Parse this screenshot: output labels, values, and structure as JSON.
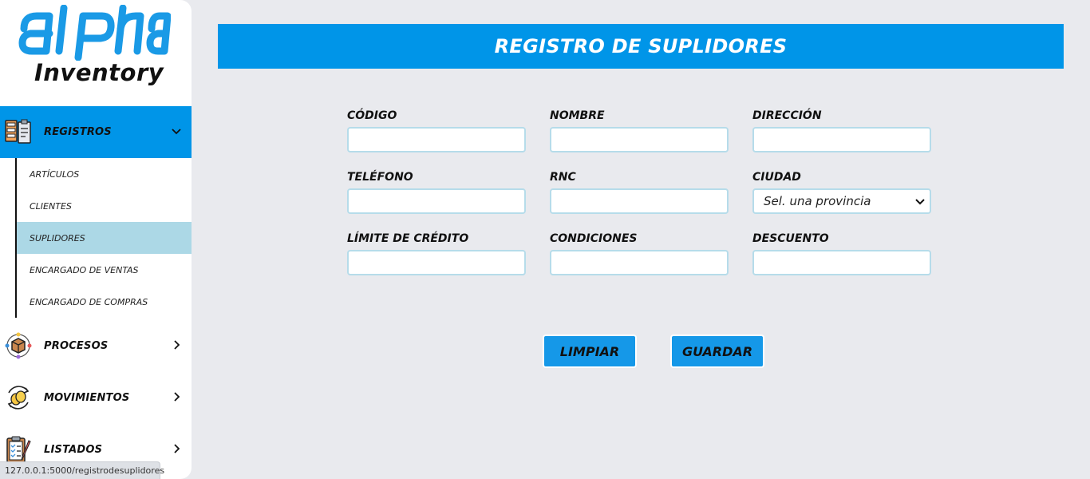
{
  "logo": {
    "brand": "alpha",
    "subtitle": "Inventory"
  },
  "sidebar": {
    "sections": [
      {
        "label": "REGISTROS",
        "icon": "records-icon",
        "expanded": true
      },
      {
        "label": "PROCESOS",
        "icon": "process-box-icon"
      },
      {
        "label": "MOVIMIENTOS",
        "icon": "coins-cycle-icon"
      },
      {
        "label": "LISTADOS",
        "icon": "clipboard-list-icon"
      }
    ],
    "sub_items": [
      {
        "label": "ARTÍCULOS"
      },
      {
        "label": "CLIENTES"
      },
      {
        "label": "SUPLIDORES",
        "selected": true
      },
      {
        "label": "ENCARGADO DE VENTAS"
      },
      {
        "label": "ENCARGADO DE COMPRAS"
      }
    ]
  },
  "page": {
    "title": "REGISTRO DE SUPLIDORES"
  },
  "form": {
    "codigo": {
      "label": "CÓDIGO",
      "value": ""
    },
    "nombre": {
      "label": "NOMBRE",
      "value": ""
    },
    "direccion": {
      "label": "DIRECCIÓN",
      "value": ""
    },
    "telefono": {
      "label": "TELÉFONO",
      "value": ""
    },
    "rnc": {
      "label": "RNC",
      "value": ""
    },
    "ciudad": {
      "label": "CIUDAD",
      "selected": "Sel. una provincia"
    },
    "limite": {
      "label": "LÍMITE DE CRÉDITO",
      "value": ""
    },
    "condiciones": {
      "label": "CONDICIONES",
      "value": ""
    },
    "descuento": {
      "label": "DESCUENTO",
      "value": ""
    }
  },
  "buttons": {
    "clear": "LIMPIAR",
    "save": "GUARDAR"
  },
  "status_bar": {
    "url": "127.0.0.1:5000/registrodesuplidores"
  },
  "colors": {
    "accent": "#0095e8",
    "selected": "#acd8e6",
    "background": "#e9eaee",
    "logo": "#1a9ae6"
  }
}
